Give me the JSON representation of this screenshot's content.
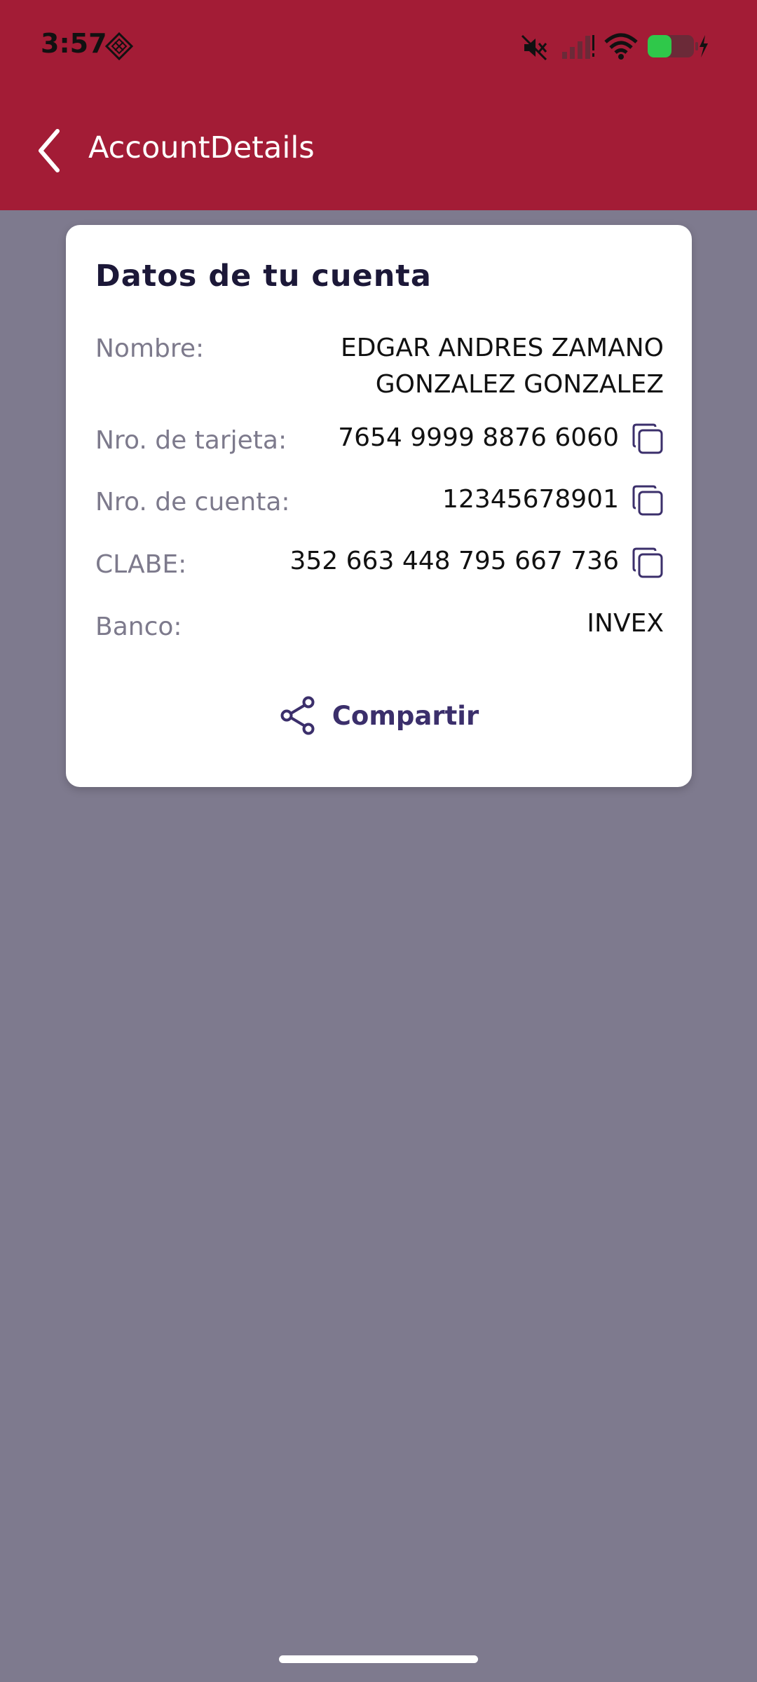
{
  "status_bar": {
    "time": "3:57",
    "icons": [
      "app-notification-icon",
      "mute-icon",
      "signal-icon",
      "wifi-icon",
      "battery-charging-icon"
    ]
  },
  "header": {
    "title": "AccountDetails",
    "back_icon": "chevron-left-icon",
    "background_color": "#a31c36"
  },
  "card": {
    "title": "Datos de tu cuenta",
    "name": {
      "label": "Nombre:",
      "value": "EDGAR ANDRES ZAMANO GONZALEZ GONZALEZ"
    },
    "card_number": {
      "label": "Nro. de tarjeta:",
      "value": "7654 9999 8876 6060"
    },
    "account_number": {
      "label": "Nro. de cuenta:",
      "value": "12345678901"
    },
    "clabe": {
      "label": "CLABE:",
      "value": "352 663 448 795 667 736"
    },
    "bank": {
      "label": "Banco:",
      "value": "INVEX"
    },
    "copy_icon": "copy-icon",
    "share": {
      "label": "Compartir",
      "icon": "share-icon"
    }
  },
  "colors": {
    "overlay_background": "#7e7a8e",
    "accent": "#3b2f6b"
  }
}
